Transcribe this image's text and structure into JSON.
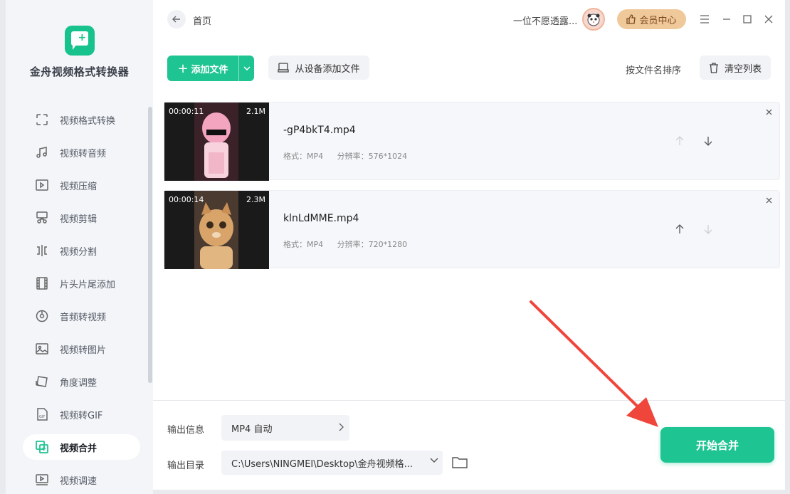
{
  "app": {
    "name": "金舟视频格式转换器"
  },
  "sidebar": {
    "items": [
      {
        "label": "视频格式转换",
        "icon": "format-convert-icon",
        "active": false
      },
      {
        "label": "视频转音频",
        "icon": "music-note-icon",
        "active": false
      },
      {
        "label": "视频压缩",
        "icon": "compress-icon",
        "active": false
      },
      {
        "label": "视频剪辑",
        "icon": "scissors-icon",
        "active": false
      },
      {
        "label": "视频分割",
        "icon": "split-icon",
        "active": false
      },
      {
        "label": "片头片尾添加",
        "icon": "film-strip-icon",
        "active": false
      },
      {
        "label": "音频转视频",
        "icon": "disc-icon",
        "active": false
      },
      {
        "label": "视频转图片",
        "icon": "image-icon",
        "active": false
      },
      {
        "label": "角度调整",
        "icon": "rotate-icon",
        "active": false
      },
      {
        "label": "视频转GIF",
        "icon": "gif-icon",
        "active": false
      },
      {
        "label": "视频合并",
        "icon": "merge-icon",
        "active": true
      },
      {
        "label": "视频调速",
        "icon": "speed-icon",
        "active": false
      }
    ]
  },
  "header": {
    "breadcrumb": "首页",
    "username": "一位不愿透露...",
    "vip_label": "会员中心"
  },
  "toolbar": {
    "add_file_label": "添加文件",
    "add_from_device_label": "从设备添加文件",
    "sort_label": "按文件名排序",
    "clear_label": "清空列表"
  },
  "files": [
    {
      "duration": "00:00:11",
      "size": "2.1M",
      "name": "-gP4bkT4.mp4",
      "format_label": "格式：",
      "format": "MP4",
      "resolution_label": "分辨率：",
      "resolution": "576*1024"
    },
    {
      "duration": "00:00:14",
      "size": "2.3M",
      "name": "klnLdMME.mp4",
      "format_label": "格式：",
      "format": "MP4",
      "resolution_label": "分辨率：",
      "resolution": "720*1280"
    }
  ],
  "output": {
    "info_label": "输出信息",
    "format_value": "MP4 自动",
    "dir_label": "输出目录",
    "dir_value": "C:\\Users\\NINGMEI\\Desktop\\金舟视频格..."
  },
  "start_button_label": "开始合并",
  "colors": {
    "accent": "#1ec491",
    "vip": "#f0c99b",
    "annotation_arrow": "#f0453a"
  }
}
